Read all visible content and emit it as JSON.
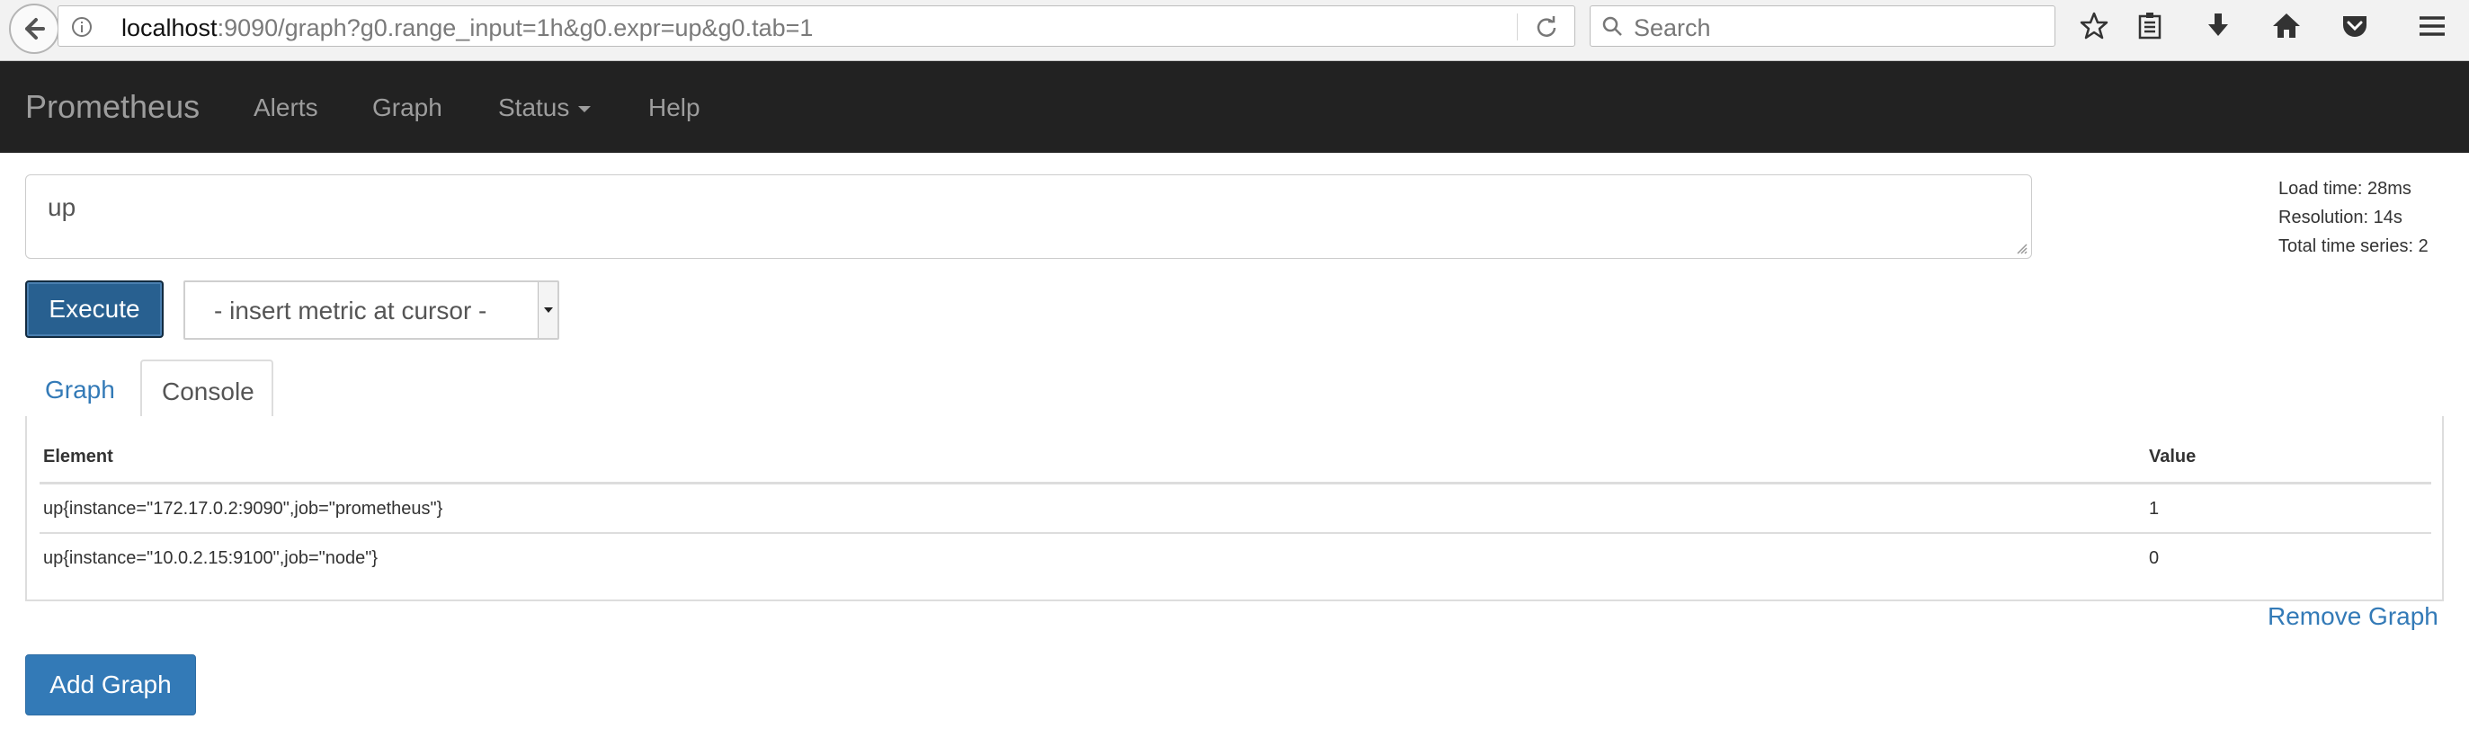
{
  "browser": {
    "url_host": "localhost",
    "url_rest": ":9090/graph?g0.range_input=1h&g0.expr=up&g0.tab=1",
    "search_placeholder": "Search"
  },
  "navbar": {
    "brand": "Prometheus",
    "items": [
      {
        "label": "Alerts"
      },
      {
        "label": "Graph"
      },
      {
        "label": "Status"
      },
      {
        "label": "Help"
      }
    ]
  },
  "query": {
    "expression": "up",
    "execute_label": "Execute",
    "metric_select_value": "- insert metric at cursor -"
  },
  "stats": {
    "load_time": "Load time: 28ms",
    "resolution": "Resolution: 14s",
    "total_series": "Total time series: 2"
  },
  "tabs": [
    {
      "label": "Graph",
      "active": false
    },
    {
      "label": "Console",
      "active": true
    }
  ],
  "console_table": {
    "headers": [
      "Element",
      "Value"
    ],
    "rows": [
      {
        "element": "up{instance=\"172.17.0.2:9090\",job=\"prometheus\"}",
        "value": "1"
      },
      {
        "element": "up{instance=\"10.0.2.15:9100\",job=\"node\"}",
        "value": "0"
      }
    ]
  },
  "actions": {
    "remove_graph": "Remove Graph",
    "add_graph": "Add Graph"
  },
  "colors": {
    "navbar_bg": "#222222",
    "link_blue": "#337ab7",
    "execute_bg": "#286090"
  }
}
